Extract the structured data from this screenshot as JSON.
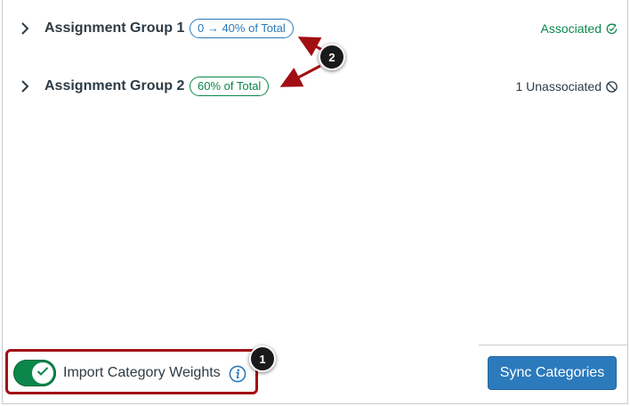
{
  "groups": [
    {
      "name": "Assignment Group 1",
      "weight_label": "0 → 40% of Total",
      "status": "Associated",
      "status_icon": "sync-check-icon"
    },
    {
      "name": "Assignment Group 2",
      "weight_label": "60% of Total",
      "status": "1 Unassociated",
      "status_icon": "prohibited-icon"
    }
  ],
  "footer": {
    "toggle_label": "Import Category Weights",
    "toggle_on": true,
    "sync_button": "Sync Categories"
  },
  "callouts": [
    "1",
    "2"
  ],
  "colors": {
    "accent_blue": "#2b7abc",
    "success_green": "#0b874b",
    "highlight_red": "#a20e14",
    "text_dark": "#2d3b45"
  }
}
